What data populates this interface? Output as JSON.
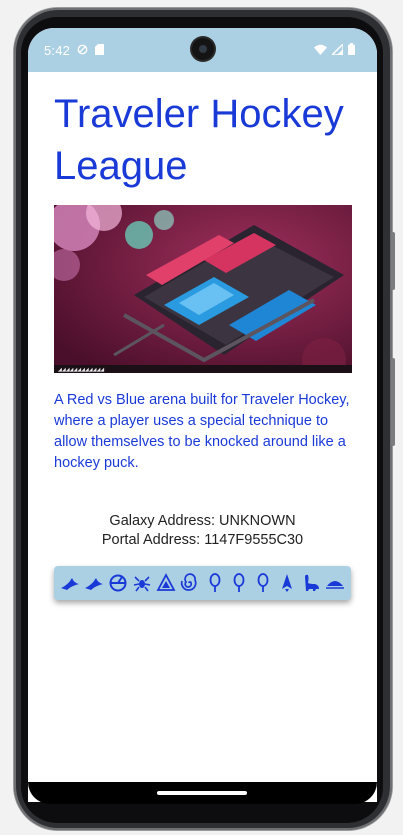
{
  "status_bar": {
    "time": "5:42",
    "background": "#acd0e3",
    "left_icons": [
      "do-not-disturb-icon",
      "sd-card-icon"
    ],
    "right_icons": [
      "wifi-icon",
      "signal-icon",
      "battery-icon"
    ]
  },
  "page": {
    "title": "Traveler Hockey League",
    "hero_image": "arena-image",
    "description": " A Red vs Blue arena built for Traveler Hockey, where a player uses a special technique to allow themselves to be knocked around like a hockey puck.",
    "galaxy_address": "Galaxy Address: UNKNOWN",
    "portal_address": "Portal Address: 1147F9555C30",
    "accent_color": "#1a3ad8",
    "glyph_bar_color": "#acd0e3",
    "portal_glyphs": [
      "glyph-1-bird-icon",
      "glyph-1-bird-icon",
      "glyph-4-eclipse-icon",
      "glyph-7-bug-icon",
      "glyph-f-voxel-icon",
      "glyph-9-galaxy-icon",
      "glyph-5-balloon-icon",
      "glyph-5-balloon-icon",
      "glyph-5-balloon-icon",
      "glyph-c-rocket-icon",
      "glyph-3-diplo-icon",
      "glyph-0-sunset-icon"
    ]
  }
}
